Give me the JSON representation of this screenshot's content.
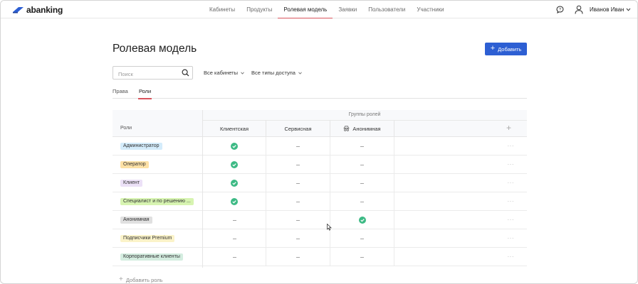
{
  "brand": {
    "logo_text": "abanking",
    "accent": "#2d5fd3"
  },
  "nav": {
    "items": [
      {
        "label": "Кабинеты",
        "active": false
      },
      {
        "label": "Продукты",
        "active": false
      },
      {
        "label": "Ролевая модель",
        "active": true
      },
      {
        "label": "Заявки",
        "active": false
      },
      {
        "label": "Пользователи",
        "active": false
      },
      {
        "label": "Участники",
        "active": false
      }
    ],
    "active_color": "#d9545d"
  },
  "user": {
    "name": "Иванов Иван"
  },
  "page": {
    "title": "Ролевая модель",
    "add_button_label": "Добавить"
  },
  "filters": {
    "search_placeholder": "Поиск",
    "cabinets": "Все кабинеты",
    "access_types": "Все типы доступа"
  },
  "tabs": [
    {
      "label": "Права",
      "active": false
    },
    {
      "label": "Роли",
      "active": true
    }
  ],
  "table": {
    "roles_header": "Роли",
    "group_header": "Группы ролей",
    "columns": [
      {
        "label": "Клиентская",
        "icon": null
      },
      {
        "label": "Сервисная",
        "icon": null
      },
      {
        "label": "Анонимная",
        "icon": "incognito-icon"
      }
    ],
    "rows": [
      {
        "role": "Администратор",
        "color": "#d4ecfb",
        "values": [
          "check",
          "dash",
          "dash"
        ]
      },
      {
        "role": "Оператор",
        "color": "#fde1a6",
        "values": [
          "check",
          "dash",
          "dash"
        ]
      },
      {
        "role": "Клиент",
        "color": "#ece1f7",
        "values": [
          "check",
          "dash",
          "dash"
        ]
      },
      {
        "role": "Специалист и по решению ...",
        "color": "#d7f4b1",
        "values": [
          "check",
          "dash",
          "dash"
        ]
      },
      {
        "role": "Анонимная",
        "color": "#e0e0e0",
        "values": [
          "dash",
          "dash",
          "check"
        ]
      },
      {
        "role": "Подписчики Premium",
        "color": "#fbf3c9",
        "values": [
          "dash",
          "dash",
          "dash"
        ]
      },
      {
        "role": "Корпоративные клиенты",
        "color": "#d4ede0",
        "values": [
          "dash",
          "dash",
          "dash"
        ]
      }
    ],
    "check_color": "#3dba85",
    "add_role_label": "Добавить роль"
  }
}
